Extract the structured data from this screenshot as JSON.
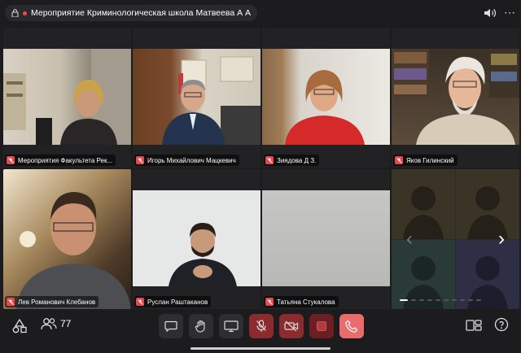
{
  "header": {
    "title": "Мероприятие Криминологическая школа Матвеева А А"
  },
  "tiles": [
    {
      "name": "Мероприятия Факультета Рек..."
    },
    {
      "name": "Игорь Михайлович Мацкевич"
    },
    {
      "name": "Зиядова Д З."
    },
    {
      "name": "Яков Гилинский"
    },
    {
      "name": "Лев Романович Клебанов"
    },
    {
      "name": "Руслан Раштаканов"
    },
    {
      "name": "Татьяна Стукалова"
    }
  ],
  "toolbar": {
    "participants_count": "77"
  },
  "colors": {
    "background": "#1c1c1e",
    "mic_off": "#e5484d",
    "hangup": "#ea6b6b"
  }
}
